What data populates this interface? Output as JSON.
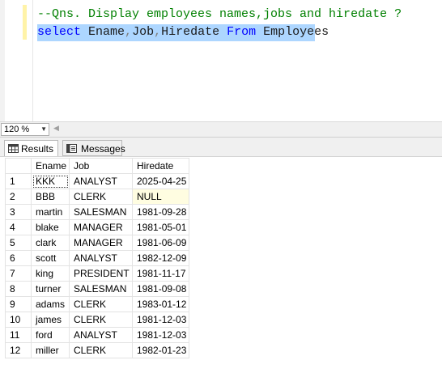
{
  "editor": {
    "comment": "--Qns. Display employees names,jobs and hiredate ?",
    "query": {
      "kw_select": "select",
      "col1": "Ename",
      "sep1": ",",
      "col2": "Job",
      "sep2": ",",
      "col3": "Hiredate",
      "kw_from": "From",
      "table": "Employees"
    }
  },
  "zoom": {
    "value": "120 %"
  },
  "tabs": {
    "results": "Results",
    "messages": "Messages"
  },
  "grid": {
    "columns": [
      "Ename",
      "Job",
      "Hiredate"
    ],
    "rows": [
      {
        "n": "1",
        "ename": "KKK",
        "job": "ANALYST",
        "hiredate": "2025-04-25"
      },
      {
        "n": "2",
        "ename": "BBB",
        "job": "CLERK",
        "hiredate": "NULL"
      },
      {
        "n": "3",
        "ename": "martin",
        "job": "SALESMAN",
        "hiredate": "1981-09-28"
      },
      {
        "n": "4",
        "ename": "blake",
        "job": "MANAGER",
        "hiredate": "1981-05-01"
      },
      {
        "n": "5",
        "ename": "clark",
        "job": "MANAGER",
        "hiredate": "1981-06-09"
      },
      {
        "n": "6",
        "ename": "scott",
        "job": "ANALYST",
        "hiredate": "1982-12-09"
      },
      {
        "n": "7",
        "ename": "king",
        "job": "PRESIDENT",
        "hiredate": "1981-11-17"
      },
      {
        "n": "8",
        "ename": "turner",
        "job": "SALESMAN",
        "hiredate": "1981-09-08"
      },
      {
        "n": "9",
        "ename": "adams",
        "job": "CLERK",
        "hiredate": "1983-01-12"
      },
      {
        "n": "10",
        "ename": "james",
        "job": "CLERK",
        "hiredate": "1981-12-03"
      },
      {
        "n": "11",
        "ename": "ford",
        "job": "ANALYST",
        "hiredate": "1981-12-03"
      },
      {
        "n": "12",
        "ename": "miller",
        "job": "CLERK",
        "hiredate": "1982-01-23"
      }
    ]
  },
  "colors": {
    "comment": "#008000",
    "keyword": "#0000ff",
    "selection": "#add6ff",
    "null_cell": "#fffde1"
  }
}
